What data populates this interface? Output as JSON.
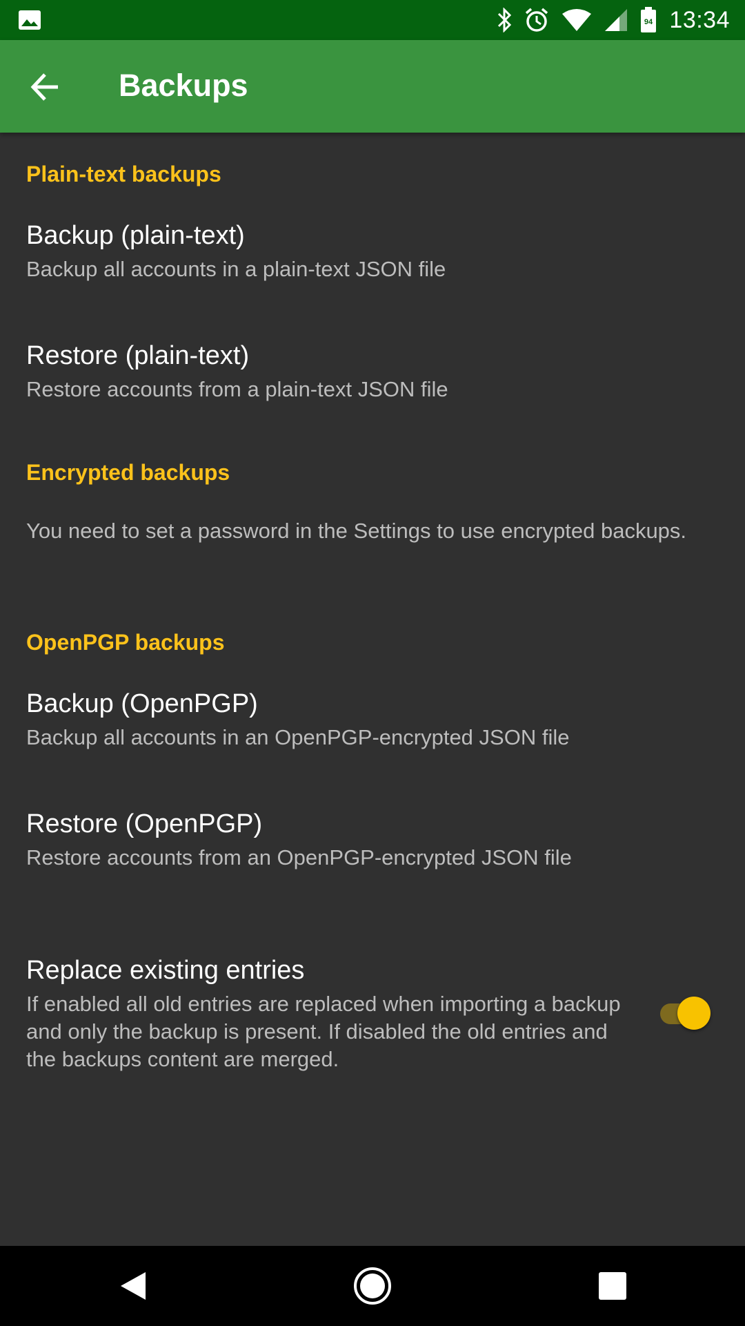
{
  "status_bar": {
    "time": "13:34",
    "battery_level": "94",
    "icons": [
      "image-icon",
      "bluetooth-icon",
      "alarm-icon",
      "wifi-icon",
      "signal-icon",
      "battery-icon"
    ]
  },
  "app_bar": {
    "title": "Backups",
    "back_icon": "arrow-back-icon",
    "color": "#3a943f"
  },
  "sections": {
    "plain": {
      "header": "Plain-text backups",
      "backup_title": "Backup (plain-text)",
      "backup_summary": "Backup all accounts in a plain-text JSON file",
      "restore_title": "Restore (plain-text)",
      "restore_summary": "Restore accounts from a plain-text JSON file"
    },
    "encrypted": {
      "header": "Encrypted backups",
      "info": "You need to set a password in the Settings to use encrypted backups."
    },
    "openpgp": {
      "header": "OpenPGP backups",
      "backup_title": "Backup (OpenPGP)",
      "backup_summary": "Backup all accounts in an OpenPGP-encrypted JSON file",
      "restore_title": "Restore (OpenPGP)",
      "restore_summary": "Restore accounts from an OpenPGP-encrypted JSON file"
    },
    "replace": {
      "title": "Replace existing entries",
      "summary": "If enabled all old entries are replaced when importing a backup and only the backup is present. If disabled the old entries and the backups content are merged.",
      "enabled": true
    }
  },
  "colors": {
    "accent": "#fcc21b",
    "status_bar": "#05630f",
    "background": "#303030"
  },
  "nav_bar": {
    "icons": [
      "nav-back-icon",
      "nav-home-icon",
      "nav-recents-icon"
    ]
  }
}
